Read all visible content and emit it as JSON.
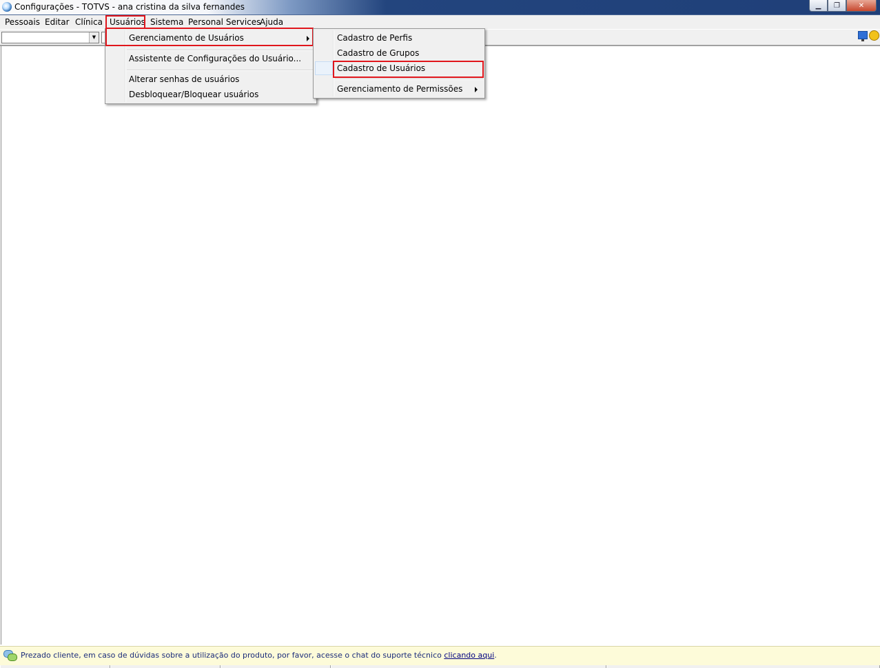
{
  "window": {
    "title": "Configurações - TOTVS - ana cristina da silva fernandes",
    "icon": "app-globe-icon",
    "buttons": {
      "minimize": "▁",
      "restore": "❐",
      "close": "✕"
    }
  },
  "menubar": {
    "items": [
      "Pessoais",
      "Editar",
      "Clínica",
      "Usuários",
      "Sistema",
      "Personal Services",
      "Ajuda"
    ],
    "open_menu": "Usuários"
  },
  "usuarios_menu": {
    "items": [
      "Gerenciamento de Usuários",
      "Assistente de Configurações do Usuário...",
      "Alterar senhas de usuários",
      "Desbloquear/Bloquear usuários"
    ]
  },
  "gerenciamento_submenu": {
    "items": [
      "Cadastro de Perfis",
      "Cadastro de Grupos",
      "Cadastro de Usuários",
      "Gerenciamento de Permissões"
    ]
  },
  "status": {
    "message": "Prezado cliente, em caso de dúvidas sobre a utilização do produto, por favor, acesse o chat do suporte técnico ",
    "link": "clicando aqui",
    "after": "."
  },
  "colors": {
    "highlight_box": "#e0151b",
    "status_background": "#fdfbd9",
    "menu_background": "#f0f0f0"
  }
}
